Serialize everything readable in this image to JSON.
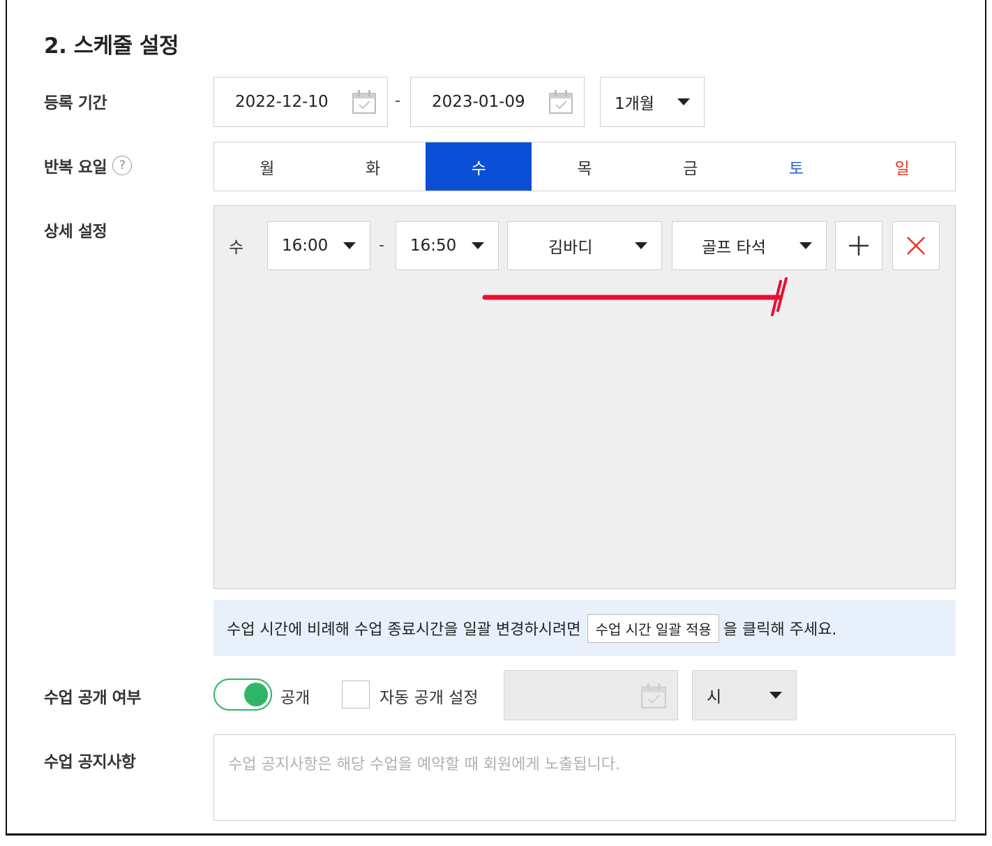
{
  "section_title": "2. 스케줄 설정",
  "labels": {
    "period": "등록 기간",
    "repeat_days": "반복 요일",
    "detail": "상세 설정",
    "public": "수업 공개 여부",
    "notice": "수업 공지사항"
  },
  "help_glyph": "?",
  "period": {
    "start_date": "2022-12-10",
    "separator": "-",
    "end_date": "2023-01-09",
    "duration": "1개월"
  },
  "days": [
    {
      "label": "월",
      "selected": false
    },
    {
      "label": "화",
      "selected": false
    },
    {
      "label": "수",
      "selected": true
    },
    {
      "label": "목",
      "selected": false
    },
    {
      "label": "금",
      "selected": false
    },
    {
      "label": "토",
      "selected": false,
      "color": "#2a5ed8"
    },
    {
      "label": "일",
      "selected": false,
      "color": "#e8321f"
    }
  ],
  "detail_row": {
    "day": "수",
    "start_time": "16:00",
    "separator": "-",
    "end_time": "16:50",
    "instructor": "김바디",
    "room": "골프 타석",
    "add_icon": "plus-icon",
    "remove_icon": "close-icon"
  },
  "info": {
    "before": "수업 시간에 비례해 수업 종료시간을 일괄 변경하시려면",
    "button": "수업 시간 일괄 적용",
    "after": "을 클릭해 주세요."
  },
  "public": {
    "enabled": true,
    "label": "공개",
    "auto_label": "자동 공개 설정",
    "auto_checked": false,
    "hour_select": "시"
  },
  "notice": {
    "placeholder": "수업 공지사항은 해당 수업을 예약할 때 회원에게 노출됩니다."
  },
  "colors": {
    "accent": "#0a4fd6",
    "toggle_on": "#2fb567",
    "annotation": "#e8102e",
    "info_bg": "#e7f0fb"
  }
}
